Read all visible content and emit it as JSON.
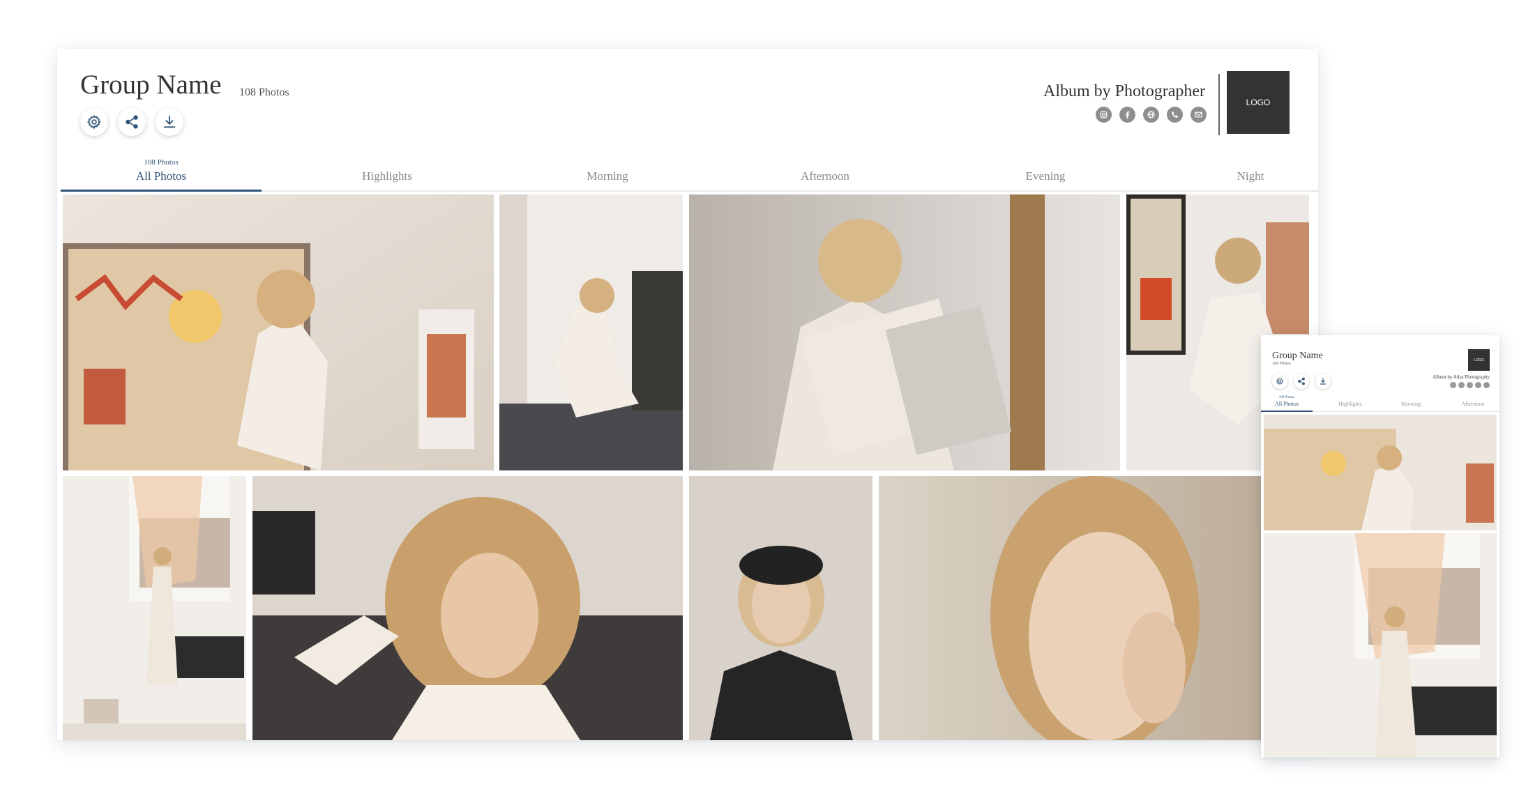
{
  "album": {
    "group_name": "Group Name",
    "photo_count": "108 Photos",
    "byline": "Album by Photographer",
    "logo_text": "LOGO"
  },
  "actions": [
    {
      "label": "Settings",
      "icon": "gear-icon"
    },
    {
      "label": "Share",
      "icon": "share-icon"
    },
    {
      "label": "Download",
      "icon": "download-icon"
    }
  ],
  "social": [
    "instagram-icon",
    "facebook-icon",
    "website-icon",
    "phone-icon",
    "email-icon"
  ],
  "tabs": [
    {
      "label": "All Photos",
      "sub": "108 Photos",
      "active": true
    },
    {
      "label": "Highlights",
      "sub": "",
      "active": false
    },
    {
      "label": "Morning",
      "sub": "",
      "active": false
    },
    {
      "label": "Afternoon",
      "sub": "",
      "active": false
    },
    {
      "label": "Evening",
      "sub": "",
      "active": false
    },
    {
      "label": "Night",
      "sub": "",
      "active": false
    }
  ],
  "mobile": {
    "group_name": "Group Name",
    "photo_count": "108 Photos",
    "byline": "Album by Atlas Photography",
    "logo_text": "LOGO",
    "tabs": [
      {
        "label": "All Photos",
        "sub": "108 Photos",
        "active": true
      },
      {
        "label": "Highlights",
        "sub": ""
      },
      {
        "label": "Morning",
        "sub": ""
      },
      {
        "label": "Afternoon",
        "sub": ""
      }
    ]
  },
  "colors": {
    "accent": "#2f5376",
    "logo_bg": "#333333",
    "social_icon": "#8e8e8e"
  }
}
